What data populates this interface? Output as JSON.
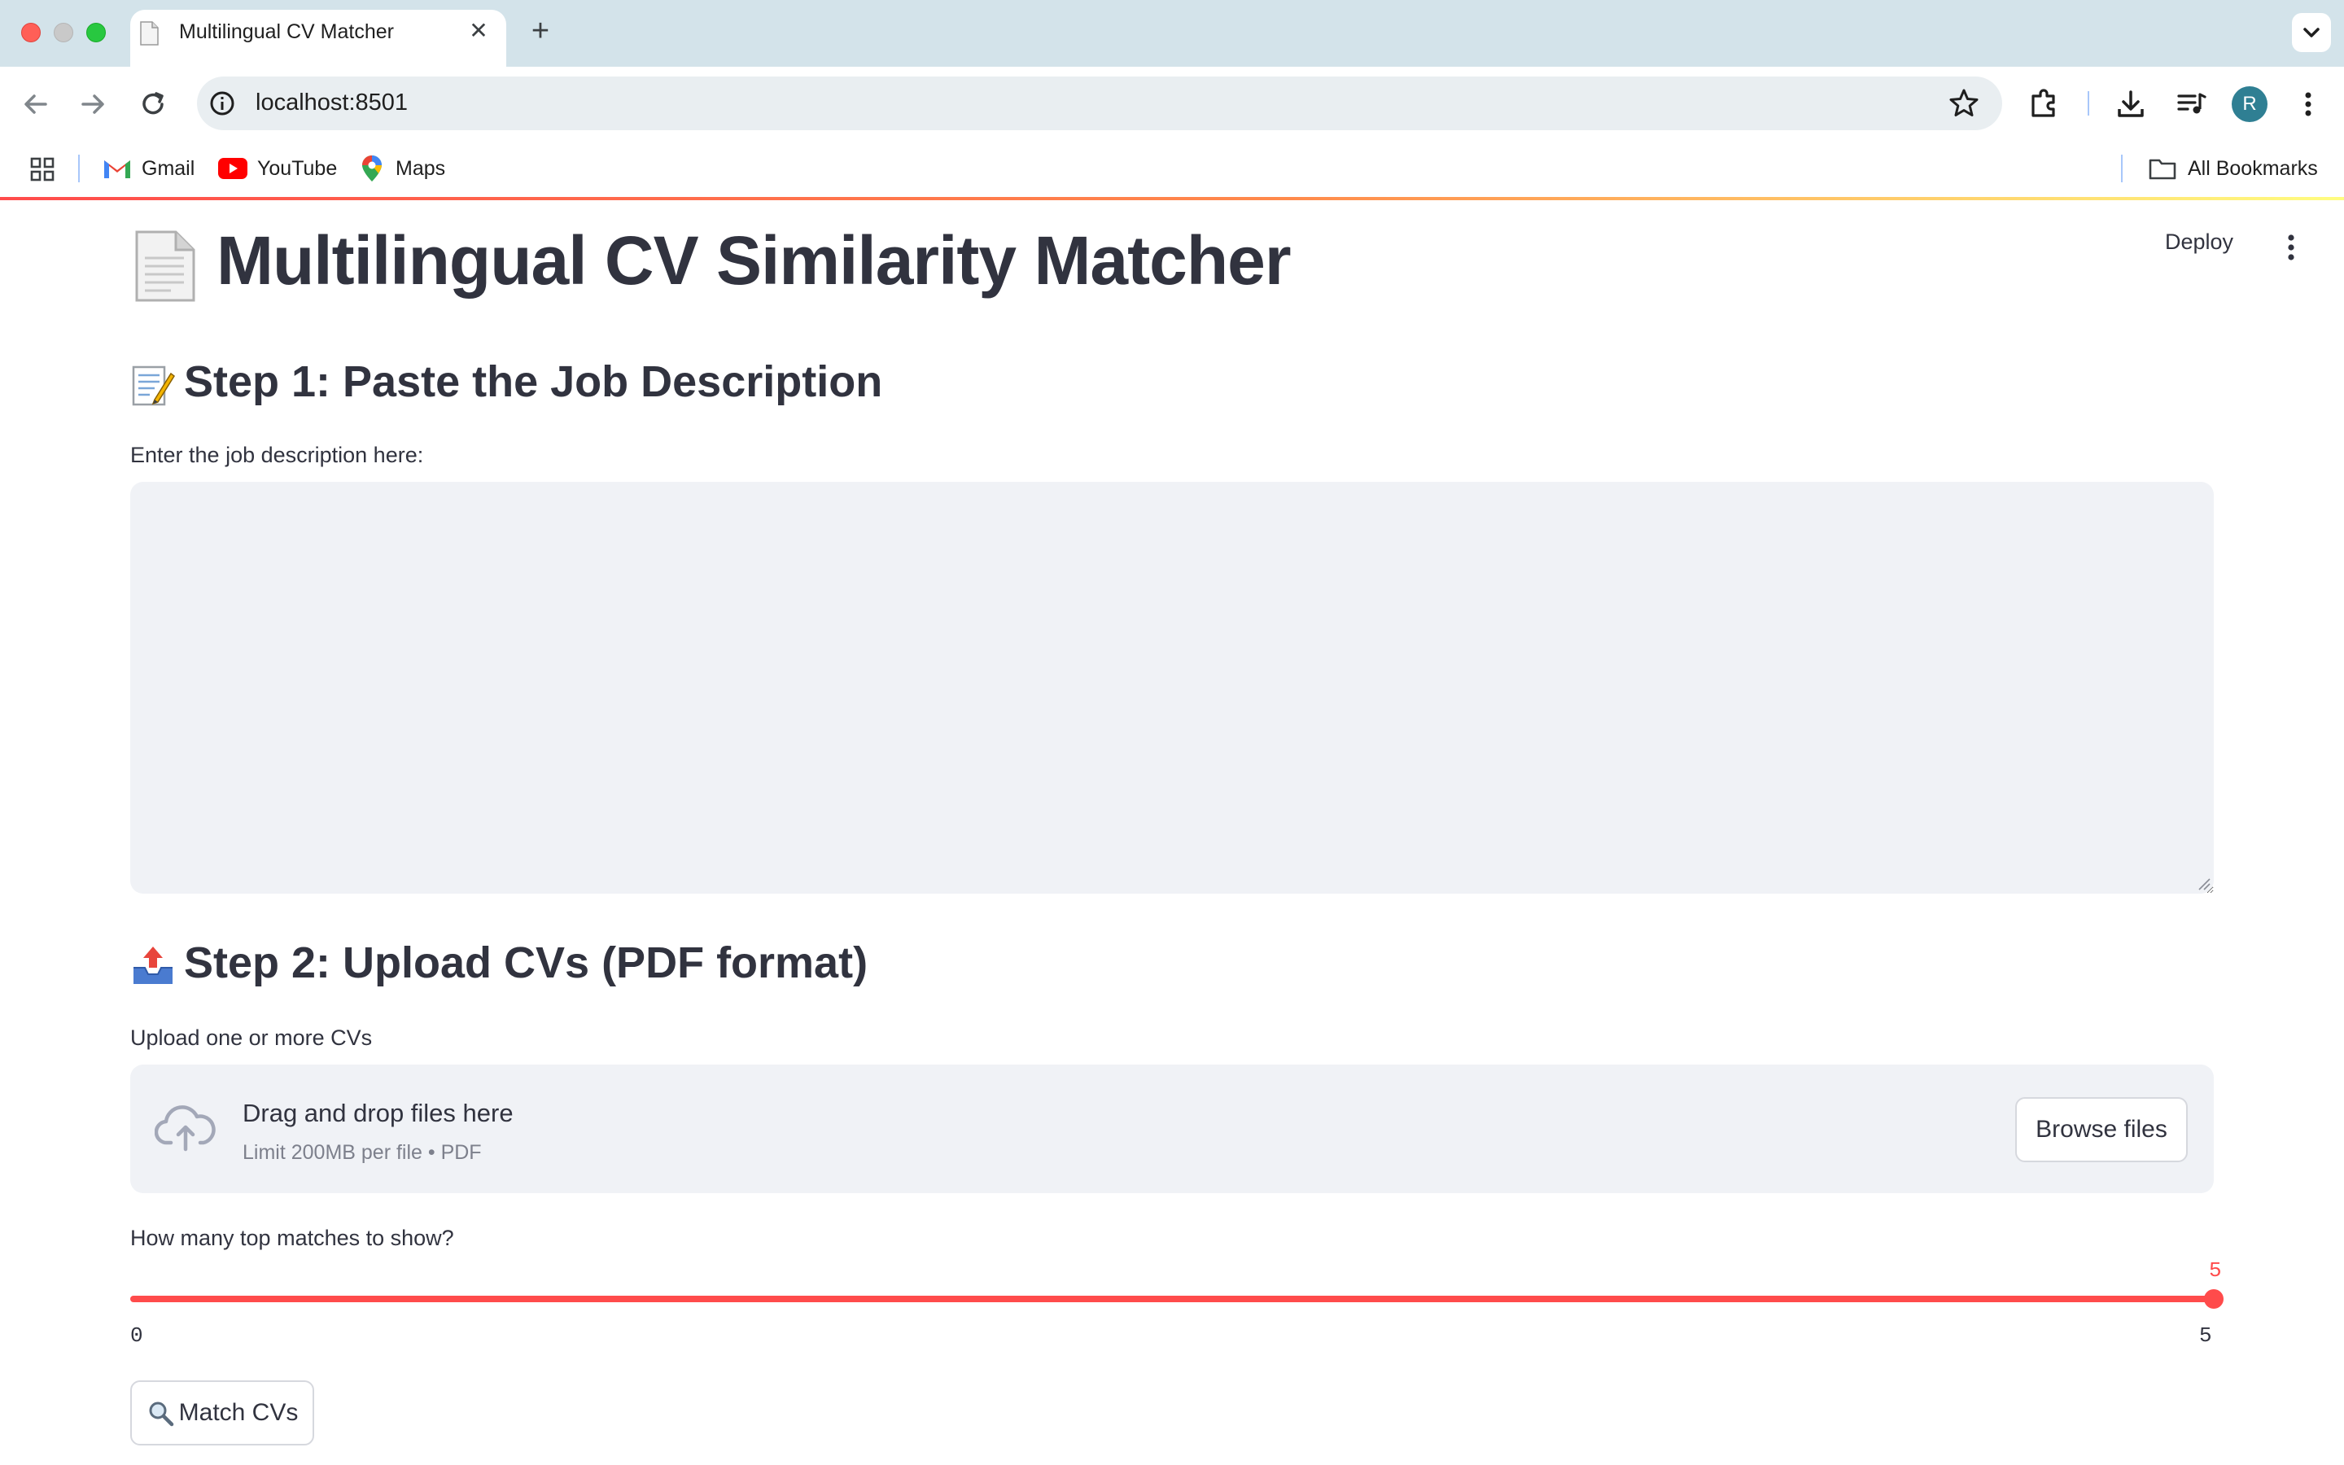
{
  "browser": {
    "tab_title": "Multilingual CV Matcher",
    "url": "localhost:8501",
    "avatar_letter": "R",
    "bookmarks": [
      {
        "label": "Gmail",
        "icon": "gmail-icon"
      },
      {
        "label": "YouTube",
        "icon": "youtube-icon"
      },
      {
        "label": "Maps",
        "icon": "maps-icon"
      }
    ],
    "all_bookmarks_label": "All Bookmarks"
  },
  "app_header": {
    "deploy_label": "Deploy"
  },
  "page": {
    "title": "Multilingual CV Similarity Matcher",
    "step1": {
      "heading": "Step 1: Paste the Job Description",
      "textarea_label": "Enter the job description here:",
      "textarea_value": ""
    },
    "step2": {
      "heading": "Step 2: Upload CVs (PDF format)",
      "uploader_label": "Upload one or more CVs",
      "dropzone_text": "Drag and drop files here",
      "dropzone_limit": "Limit 200MB per file • PDF",
      "browse_label": "Browse files"
    },
    "slider": {
      "label": "How many top matches to show?",
      "value": "5",
      "min": "0",
      "max": "5"
    },
    "match_button_label": "Match CVs"
  },
  "colors": {
    "accent": "#ff4b4b",
    "text": "#31333f",
    "input_bg": "#f0f2f6",
    "chrome_tabstrip": "#d3e3ea"
  }
}
